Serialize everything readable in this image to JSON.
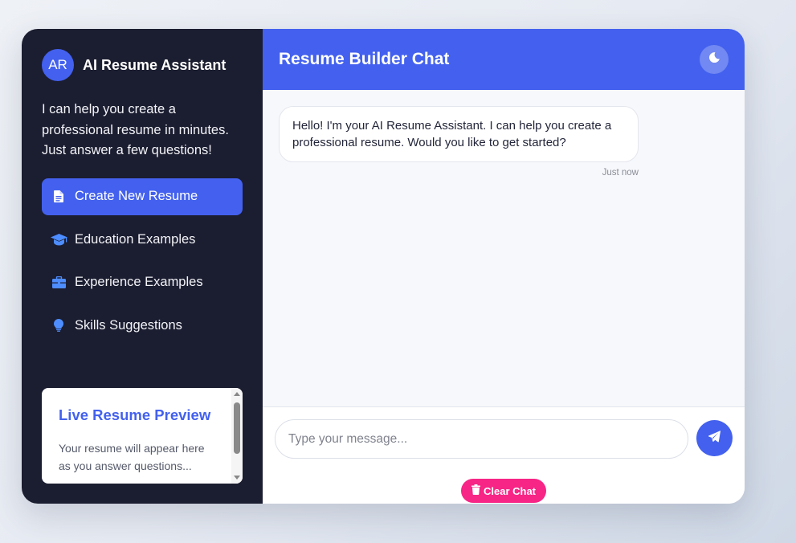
{
  "sidebar": {
    "avatar_initials": "AR",
    "brand_name": "AI Resume Assistant",
    "intro": "I can help you create a professional resume in minutes. Just answer a few questions!",
    "items": [
      {
        "label": "Create New Resume",
        "icon": "document-icon",
        "active": true
      },
      {
        "label": "Education Examples",
        "icon": "graduation-cap-icon",
        "active": false
      },
      {
        "label": "Experience Examples",
        "icon": "briefcase-icon",
        "active": false
      },
      {
        "label": "Skills Suggestions",
        "icon": "lightbulb-icon",
        "active": false
      }
    ],
    "preview": {
      "title": "Live Resume Preview",
      "text": "Your resume will appear here as you answer questions..."
    }
  },
  "header": {
    "title": "Resume Builder Chat",
    "theme_toggle_icon": "moon-icon"
  },
  "messages": [
    {
      "sender": "assistant",
      "text": "Hello! I'm your AI Resume Assistant. I can help you create a professional resume. Would you like to get started?",
      "time": "Just now"
    }
  ],
  "composer": {
    "placeholder": "Type your message...",
    "send_icon": "paper-plane-icon",
    "clear_label": "Clear Chat",
    "clear_icon": "trash-icon"
  },
  "colors": {
    "accent": "#4361ee",
    "sidebar_bg": "#1b1d30",
    "clear_button": "#f72585"
  }
}
